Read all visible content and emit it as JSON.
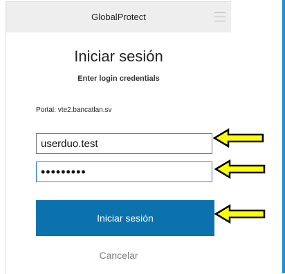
{
  "window": {
    "title": "GlobalProtect",
    "menu_icon": "hamburger-menu-icon"
  },
  "login": {
    "heading": "Iniciar sesión",
    "subheading": "Enter login credentials",
    "portal_label": "Portal:",
    "portal_value": "vte2.bancatlan.sv",
    "username_value": "userduo.test",
    "password_value": "•••••••••",
    "submit_label": "Iniciar sesión",
    "cancel_label": "Cancelar"
  },
  "annotations": {
    "arrow_icon": "left-arrow-icon",
    "arrow_color": "#ffff00",
    "arrow_outline": "#000000"
  },
  "colors": {
    "primary_button": "#0b72ad",
    "focus_border": "#2a7fd4",
    "titlebar": "#eeeeee",
    "cancel_text": "#808080"
  }
}
